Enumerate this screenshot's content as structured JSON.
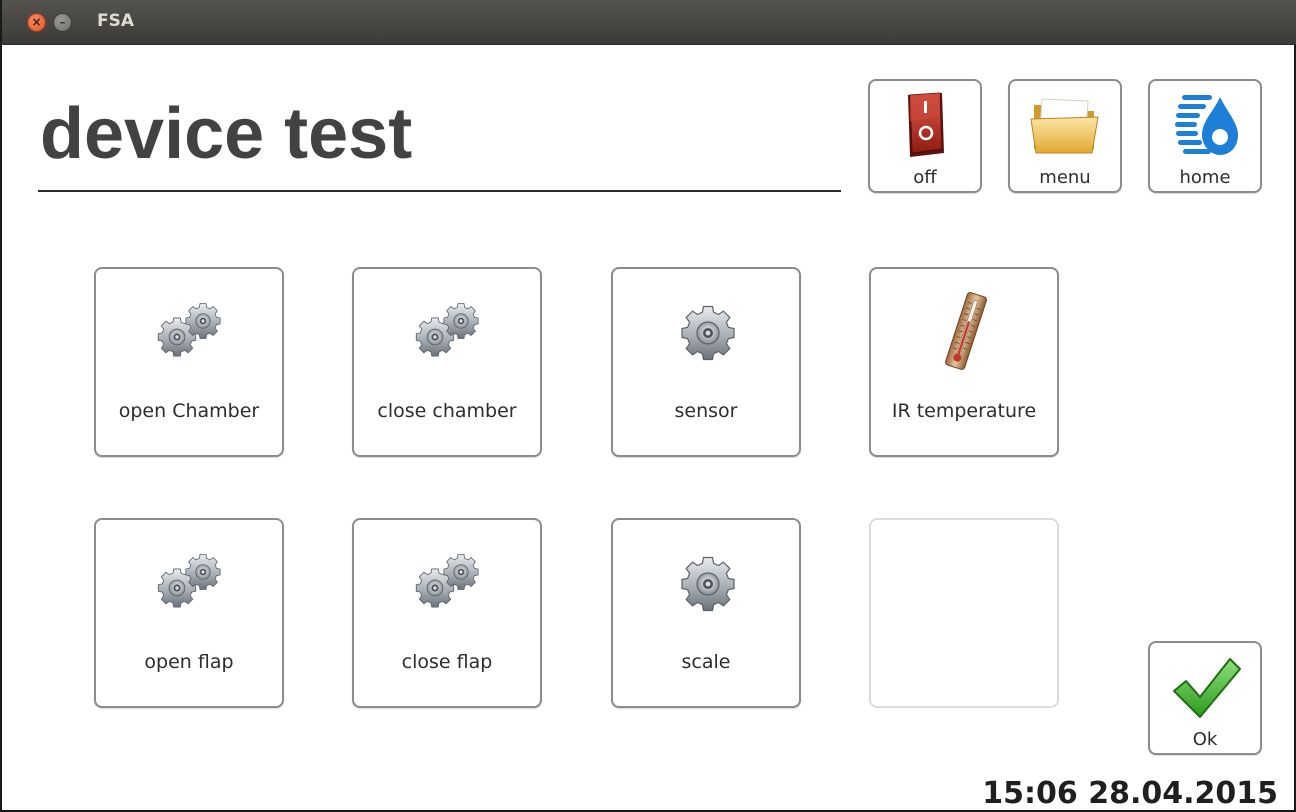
{
  "window": {
    "title": "FSA"
  },
  "page": {
    "title": "device test"
  },
  "toolbar": {
    "off_label": "off",
    "menu_label": "menu",
    "home_label": "home"
  },
  "tiles": [
    {
      "label": "open Chamber",
      "icon": "gears-icon"
    },
    {
      "label": "close chamber",
      "icon": "gears-icon"
    },
    {
      "label": "sensor",
      "icon": "gear-icon"
    },
    {
      "label": "IR temperature",
      "icon": "thermometer-icon"
    },
    {
      "label": "open flap",
      "icon": "gears-icon"
    },
    {
      "label": "close flap",
      "icon": "gears-icon"
    },
    {
      "label": "scale",
      "icon": "gear-icon"
    },
    {
      "label": "",
      "icon": "",
      "disabled": true
    }
  ],
  "ok_label": "Ok",
  "status": {
    "datetime": "15:06 28.04.2015"
  },
  "colors": {
    "titlebar": "#3c3b37",
    "page_title": "#424242",
    "ok_check": "#3cab2c",
    "power_switch": "#c0392b",
    "folder": "#f0c860",
    "home_logo": "#1d7fd6"
  }
}
